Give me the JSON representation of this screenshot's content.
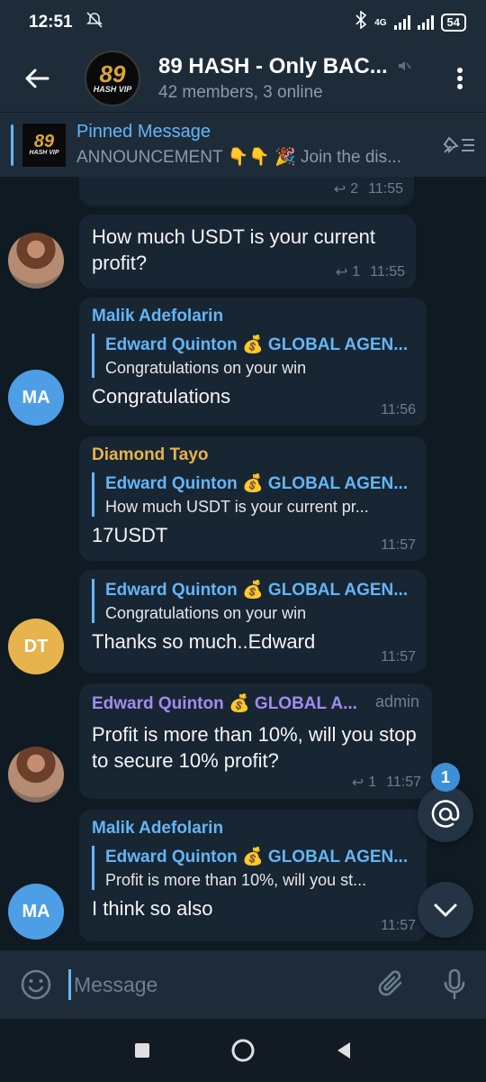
{
  "status": {
    "time": "12:51",
    "battery": "54",
    "network": "4G"
  },
  "header": {
    "title": "89 HASH - Only BAC...",
    "subtitle": "42 members, 3 online",
    "logo_num": "89",
    "logo_sub": "HASH VIP"
  },
  "pinned": {
    "title": "Pinned Message",
    "body": "ANNOUNCEMENT 👇👇 🎉 Join the dis..."
  },
  "messages": [
    {
      "id": "m0",
      "text": "",
      "replies": "2",
      "time": "11:55"
    },
    {
      "id": "m1",
      "text": "How much USDT is your current profit?",
      "replies": "1",
      "time": "11:55"
    },
    {
      "id": "m2",
      "sender": "Malik Adefolarin",
      "reply_name": "Edward Quinton 💰 GLOBAL AGEN...",
      "reply_text": "Congratulations on your win",
      "text": "Congratulations",
      "time": "11:56",
      "avatar": "MA"
    },
    {
      "id": "m3",
      "sender": "Diamond Tayo",
      "reply_name": "Edward Quinton 💰 GLOBAL AGEN...",
      "reply_text": "How much USDT is your current pr...",
      "text": "17USDT",
      "time": "11:57"
    },
    {
      "id": "m4",
      "reply_name": "Edward Quinton 💰 GLOBAL AGEN...",
      "reply_text": "Congratulations on your win",
      "text": "Thanks so much..Edward",
      "time": "11:57",
      "avatar": "DT"
    },
    {
      "id": "m5",
      "sender": "Edward Quinton 💰 GLOBAL A...",
      "role": "admin",
      "text": "Profit is more than 10%, will you stop to secure 10% profit?",
      "replies": "1",
      "time": "11:57"
    },
    {
      "id": "m6",
      "sender": "Malik Adefolarin",
      "reply_name": "Edward Quinton 💰 GLOBAL AGEN...",
      "reply_text": "Profit is more than 10%, will you st...",
      "text": "I think so also",
      "time": "11:57",
      "avatar": "MA"
    }
  ],
  "mention_badge": "1",
  "input": {
    "placeholder": "Message"
  },
  "colors": {
    "accent": "#64b5f6",
    "sender_blue": "#64b5f6",
    "sender_orange": "#e7b34c",
    "sender_purple": "#9f8cf0",
    "bubble": "#182533",
    "background": "#0f1a23"
  }
}
